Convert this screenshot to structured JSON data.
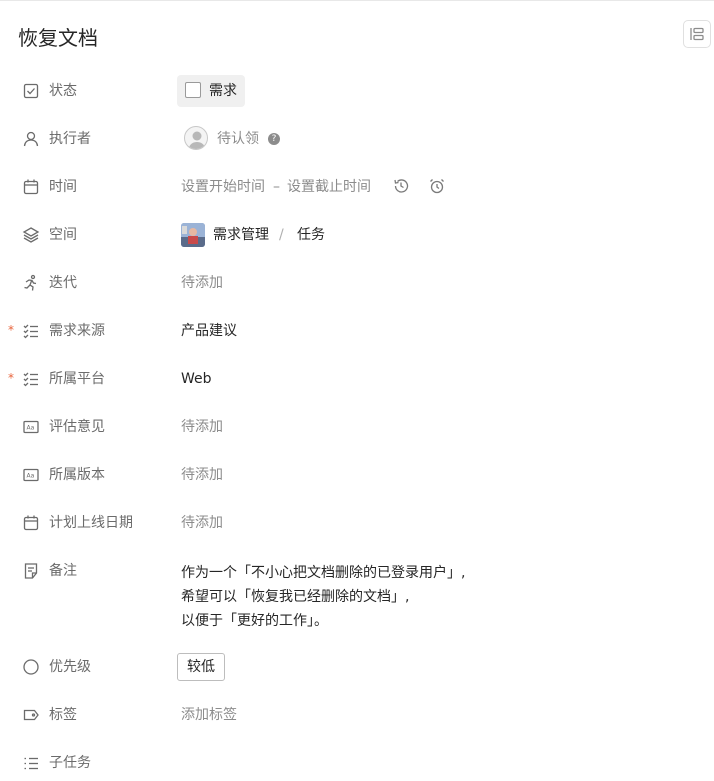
{
  "title": "恢复文档",
  "fields": {
    "status": {
      "label": "状态",
      "value": "需求"
    },
    "assignee": {
      "label": "执行者",
      "value": "待认领",
      "help": "?"
    },
    "time": {
      "label": "时间",
      "start": "设置开始时间",
      "separator": "–",
      "end": "设置截止时间"
    },
    "space": {
      "label": "空间",
      "project": "需求管理",
      "separator": "/",
      "type": "任务"
    },
    "iteration": {
      "label": "迭代",
      "value": "待添加"
    },
    "source": {
      "label": "需求来源",
      "required_mark": "*",
      "value": "产品建议"
    },
    "platform": {
      "label": "所属平台",
      "required_mark": "*",
      "value": "Web"
    },
    "review": {
      "label": "评估意见",
      "value": "待添加"
    },
    "version": {
      "label": "所属版本",
      "value": "待添加"
    },
    "launch_date": {
      "label": "计划上线日期",
      "value": "待添加"
    },
    "notes": {
      "label": "备注",
      "lines": [
        "作为一个「不小心把文档删除的已登录用户」,",
        "希望可以「恢复我已经删除的文档」,",
        "以便于「更好的工作」。"
      ]
    },
    "priority": {
      "label": "优先级",
      "value": "较低"
    },
    "tags": {
      "label": "标签",
      "value": "添加标签"
    },
    "subtasks": {
      "label": "子任务"
    }
  },
  "colors": {
    "required": "#e8643c",
    "label": "#6b6b6b",
    "muted": "#8c8c8c",
    "text": "#262626"
  },
  "icons": {
    "layout": "layout-list-icon",
    "status": "checkbox-icon",
    "assignee": "user-icon",
    "time": "calendar-icon",
    "space": "layers-icon",
    "iteration": "running-icon",
    "source": "list-check-icon",
    "platform": "list-check-icon",
    "review": "text-field-icon",
    "version": "text-field-icon",
    "launch_date": "calendar-icon",
    "notes": "note-icon",
    "priority": "circle-icon",
    "tags": "tag-icon",
    "subtasks": "list-icon"
  }
}
